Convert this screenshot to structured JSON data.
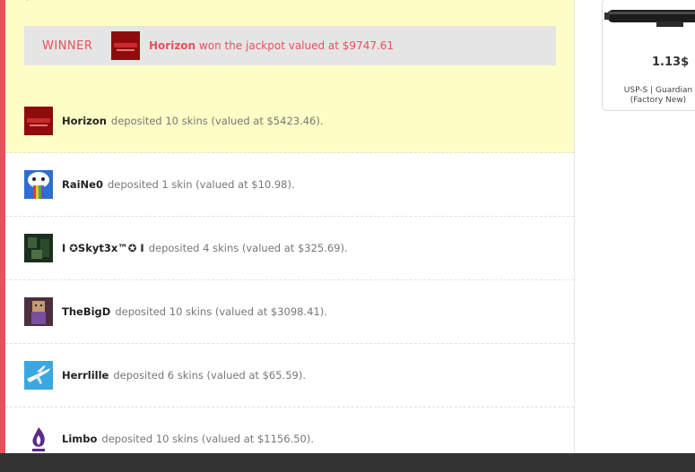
{
  "winner": {
    "label": "WINNER",
    "name": "Horizon",
    "message": "won the jackpot valued at $9747.61"
  },
  "deposits": [
    {
      "name": "Horizon",
      "text": "deposited 10 skins (valued at $5423.46).",
      "highlight": true
    },
    {
      "name": "RaiNe0",
      "text": "deposited 1 skin (valued at $10.98)."
    },
    {
      "name": "I ✪Skyt3x™✪ I",
      "text": "deposited 4 skins (valued at $325.69)."
    },
    {
      "name": "TheBigD",
      "text": "deposited 10 skins (valued at $3098.41)."
    },
    {
      "name": "Herrlille",
      "text": "deposited 6 skins (valued at $65.59)."
    },
    {
      "name": "Limbo",
      "text": "deposited 10 skins (valued at $1156.50)."
    }
  ],
  "item": {
    "price": "1.13$",
    "name": "USP-S | Guardian (Factory New)"
  },
  "colors": {
    "accent": "#e8515a",
    "highlight": "#fdfdc6"
  }
}
